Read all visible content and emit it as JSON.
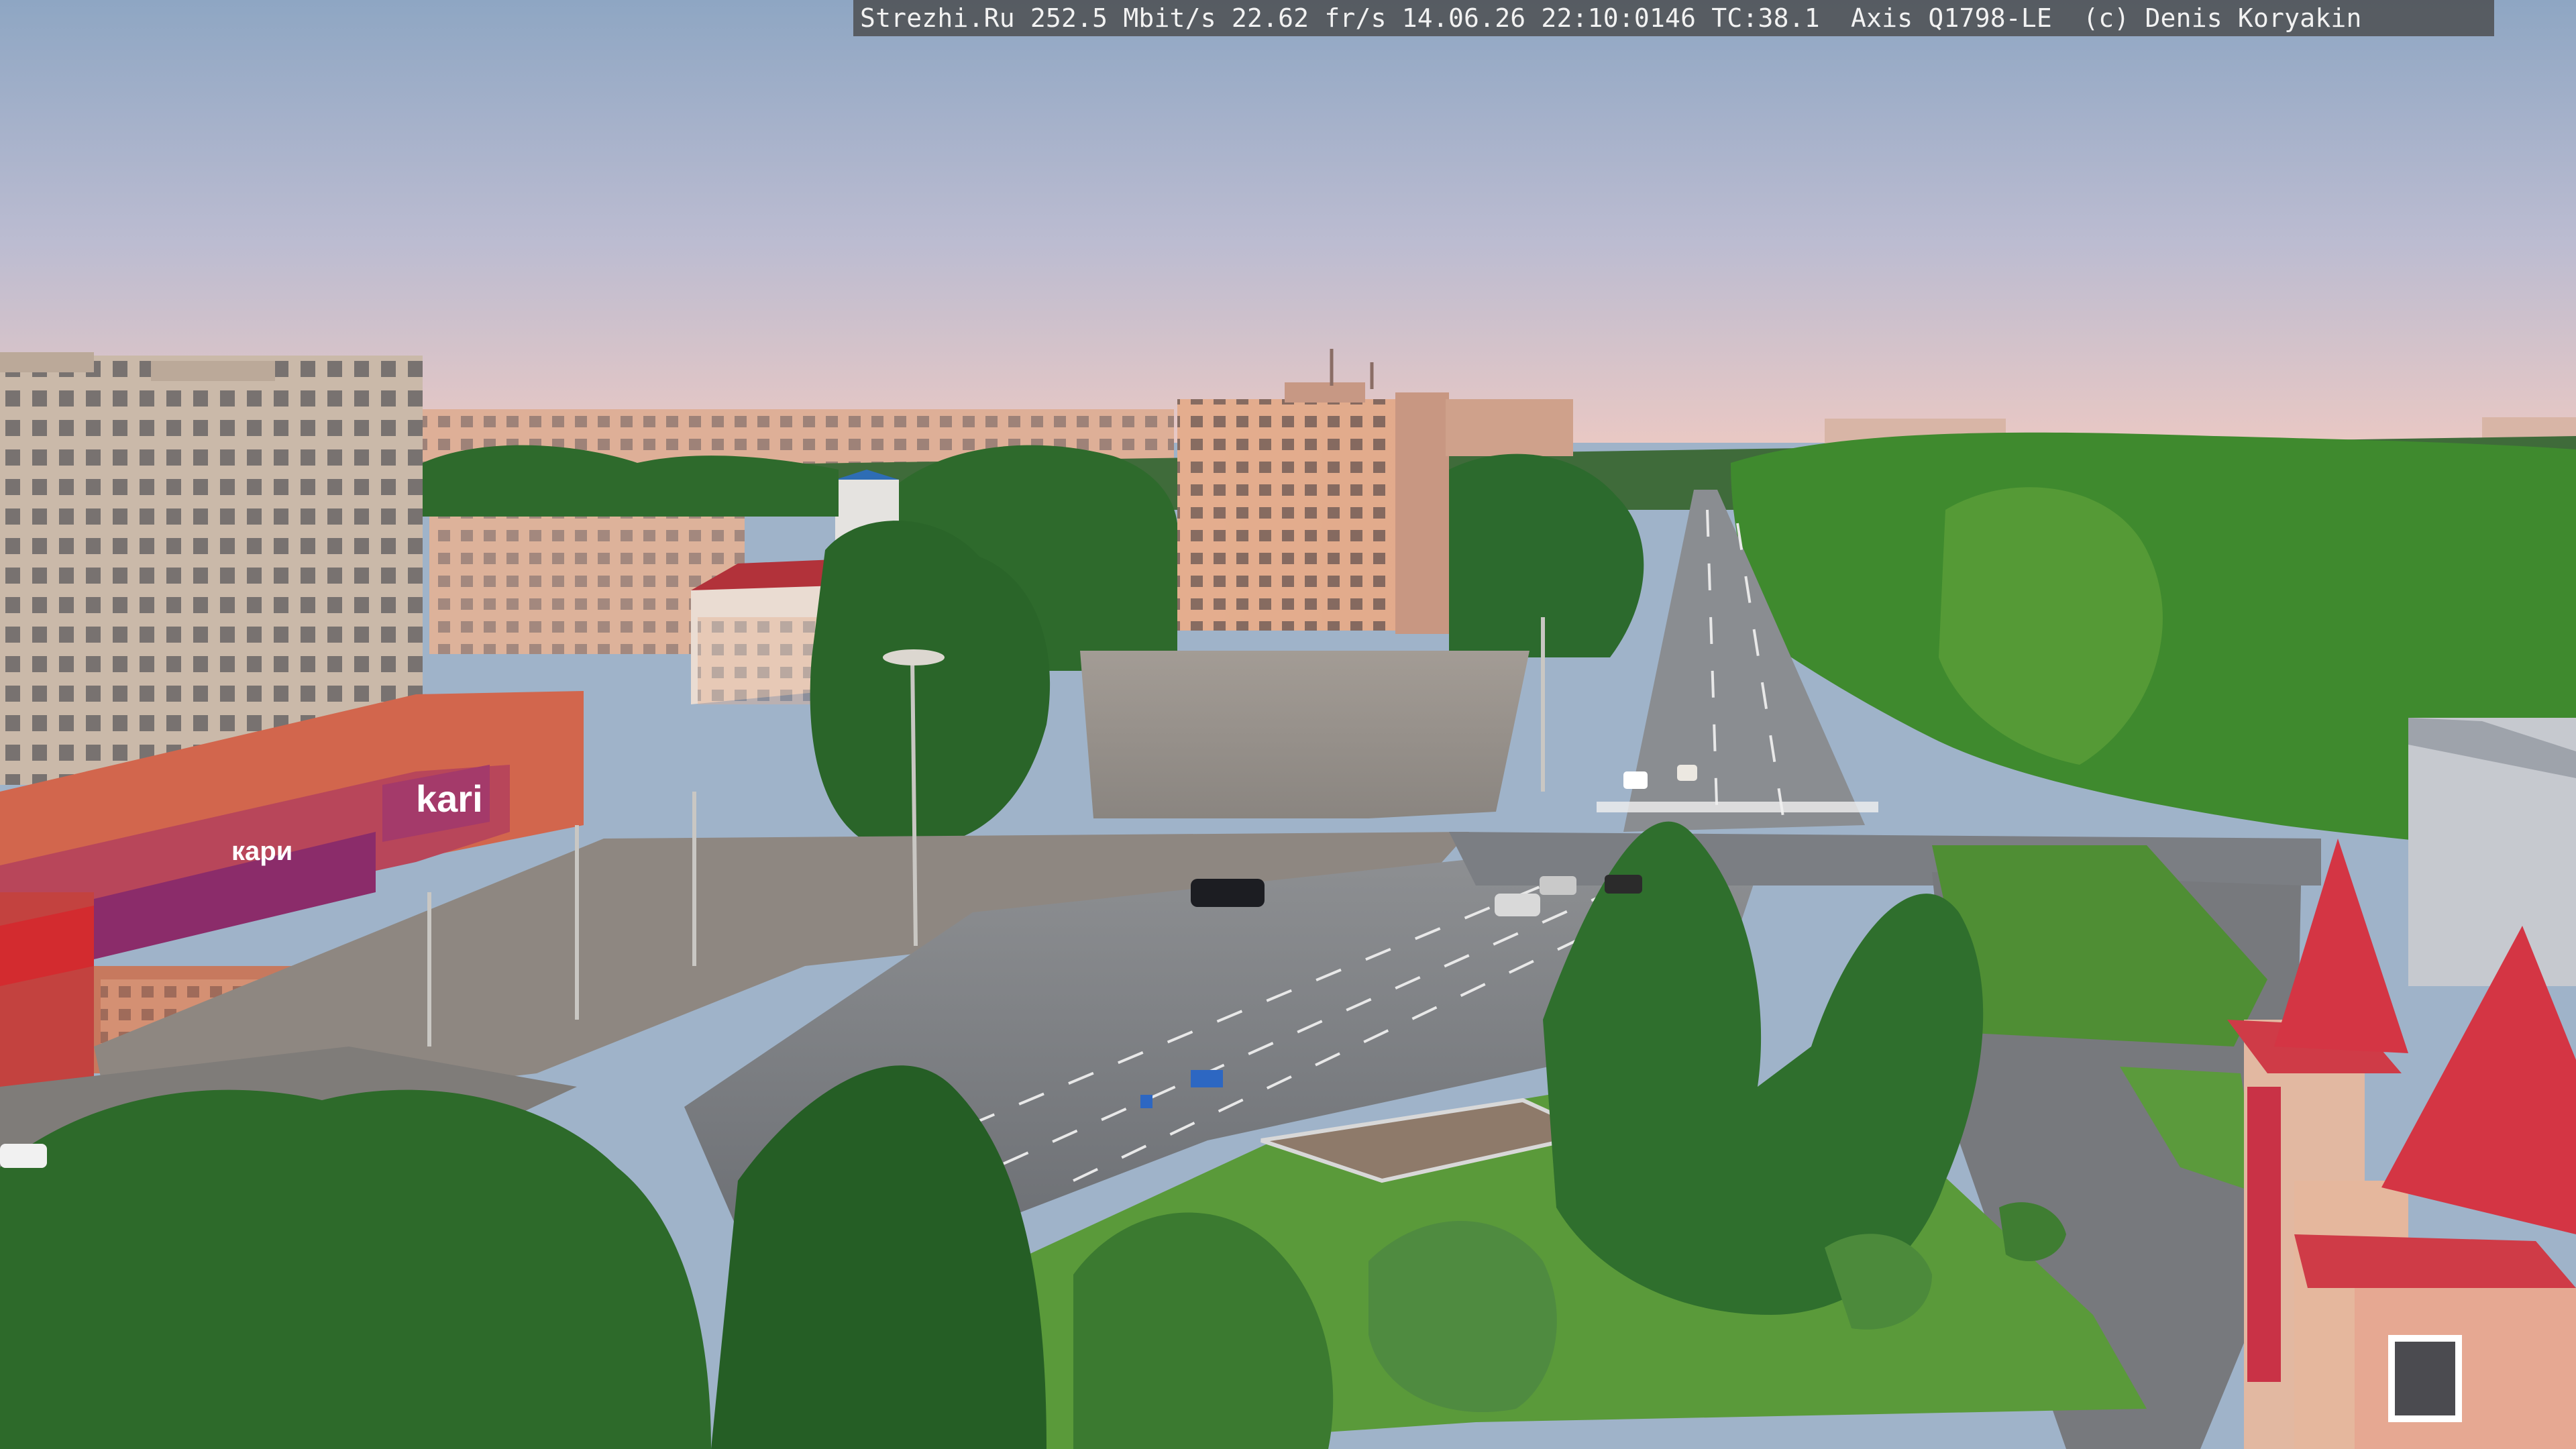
{
  "camera_overlay": {
    "text": "Strezhi.Ru 252.5 Mbit/s 22.62 fr/s 14.06.26 22:10:0146 TC:38.1  Axis Q1798-LE  (c) Denis Koryakin"
  },
  "storefront": {
    "brand": "kari",
    "banner": "кари"
  },
  "colors": {
    "sky_top": "#8fa7c3",
    "sky_bottom": "#e8c6c3",
    "trees": "#2f6e2a",
    "road": "#6f7378",
    "roof_red": "#c8303f"
  }
}
